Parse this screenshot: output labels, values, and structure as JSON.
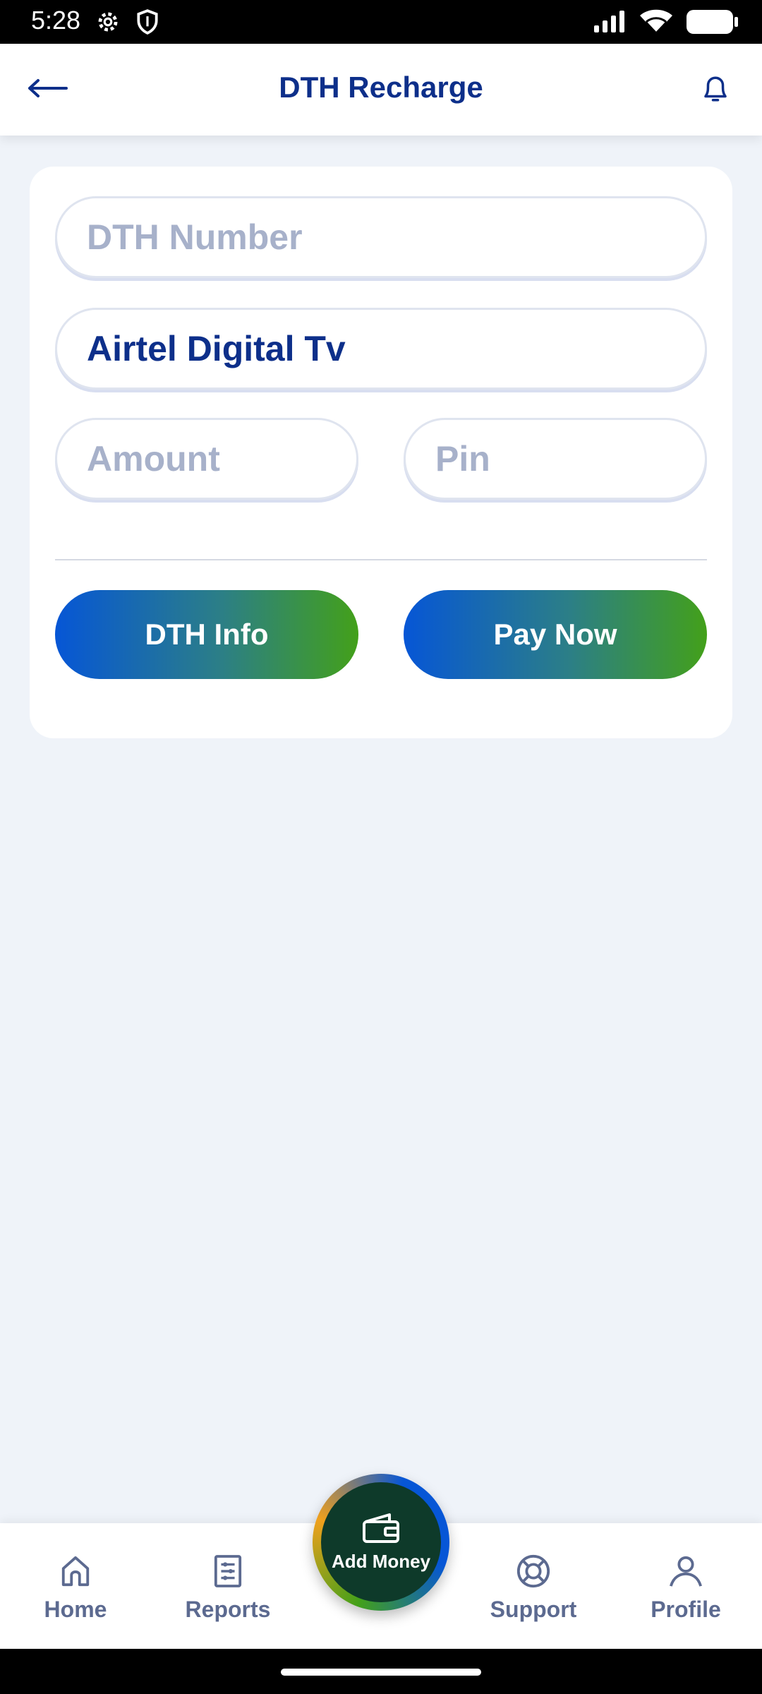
{
  "status_bar": {
    "time": "5:28",
    "left_icons": [
      "gear-icon",
      "shield-icon"
    ],
    "right_icons": [
      "signal-icon",
      "wifi-icon",
      "battery-icon"
    ]
  },
  "header": {
    "title": "DTH Recharge",
    "back_icon": "arrow-left-icon",
    "notification_icon": "bell-icon"
  },
  "form": {
    "dth_number": {
      "placeholder": "DTH Number",
      "value": ""
    },
    "operator": {
      "value": "Airtel Digital Tv"
    },
    "amount": {
      "placeholder": "Amount",
      "value": ""
    },
    "pin": {
      "placeholder": "Pin",
      "value": ""
    },
    "dth_info_label": "DTH Info",
    "pay_now_label": "Pay Now"
  },
  "bottom_nav": {
    "items": [
      {
        "label": "Home",
        "icon": "home-icon"
      },
      {
        "label": "Reports",
        "icon": "reports-icon"
      },
      {
        "label": "Support",
        "icon": "lifebuoy-icon"
      },
      {
        "label": "Profile",
        "icon": "user-icon"
      }
    ],
    "center_button": {
      "label": "Add Money",
      "icon": "wallet-icon"
    }
  },
  "colors": {
    "primary": "#0d2f8a",
    "gradient_start": "#0656d6",
    "gradient_end": "#43a01a",
    "background": "#eff3f9",
    "nav_text": "#5c6a90"
  }
}
